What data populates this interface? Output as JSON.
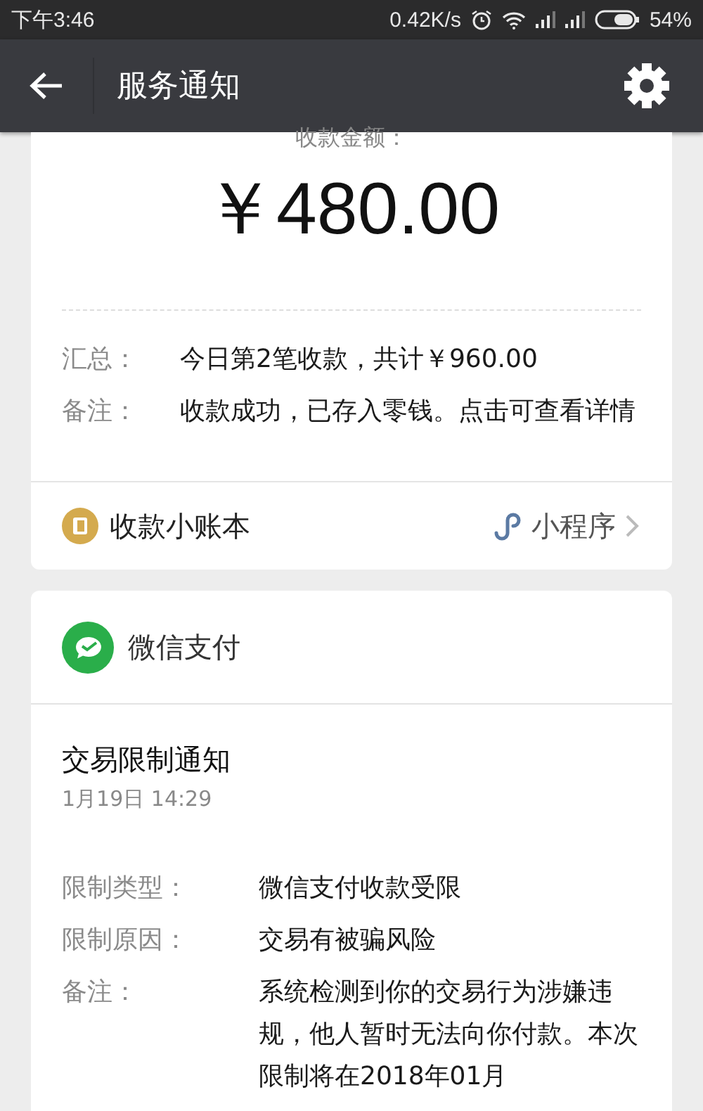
{
  "status_bar": {
    "time": "下午3:46",
    "speed": "0.42K/s",
    "battery": "54%"
  },
  "app_bar": {
    "title": "服务通知"
  },
  "receipt": {
    "amount_label": "收款金额：",
    "amount": "￥480.00",
    "rows": [
      {
        "label": "汇总：",
        "value": "今日第2笔收款，共计￥960.00"
      },
      {
        "label": "备注：",
        "value": "收款成功，已存入零钱。点击可查看详情"
      }
    ],
    "footer": {
      "name": "收款小账本",
      "mini_program": "小程序"
    }
  },
  "notice": {
    "source": "微信支付",
    "title": "交易限制通知",
    "date": "1月19日  14:29",
    "rows": [
      {
        "label": "限制类型：",
        "value": "微信支付收款受限"
      },
      {
        "label": "限制原因：",
        "value": "交易有被骗风险"
      },
      {
        "label": "备注：",
        "value": "系统检测到你的交易行为涉嫌违规，他人暂时无法向你付款。本次限制将在2018年01月"
      }
    ]
  }
}
